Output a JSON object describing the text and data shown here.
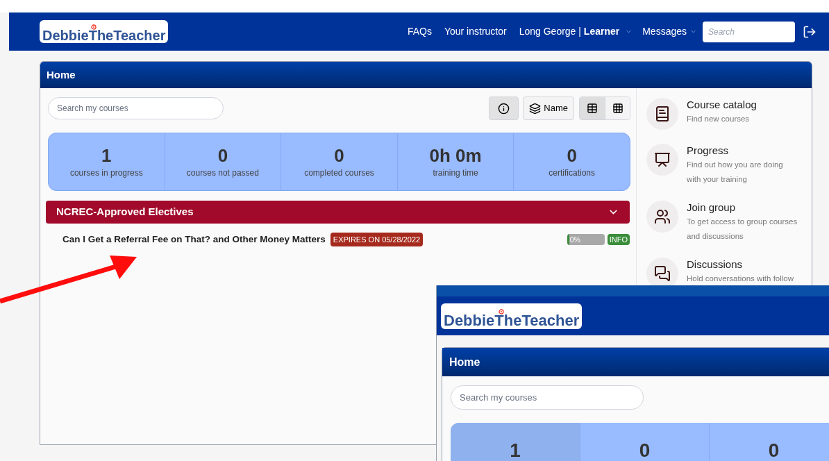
{
  "nav": {
    "logo": "DebbieTheTeacher",
    "links": [
      "FAQs",
      "Your instructor"
    ],
    "user": {
      "name": "Long George",
      "separator": "|",
      "role": "Learner"
    },
    "messages": "Messages",
    "search": {
      "placeholder": "Search"
    }
  },
  "home": {
    "title": "Home",
    "search": {
      "placeholder": "Search my courses"
    },
    "sort_label": "Name",
    "info_pressed": true,
    "views": [
      {
        "kind": "list",
        "selected": true
      },
      {
        "kind": "grid",
        "selected": false
      }
    ],
    "stats": [
      {
        "value": "1",
        "label": "courses in progress"
      },
      {
        "value": "0",
        "label": "courses not passed"
      },
      {
        "value": "0",
        "label": "completed courses"
      },
      {
        "value": "0h 0m",
        "label": "training time"
      },
      {
        "value": "0",
        "label": "certifications"
      }
    ],
    "categories": [
      {
        "title": "NCREC-Approved Electives",
        "expanded": true,
        "courses": [
          {
            "title": "Can I Get a Referral Fee on That? and Other Money Matters",
            "expires": "EXPIRES ON 05/28/2022",
            "level": 0,
            "progress": "0%",
            "info": "INFO"
          }
        ]
      }
    ],
    "sidebar": [
      {
        "kind": "catalog",
        "title": "Course catalog",
        "description": "Find new courses"
      },
      {
        "kind": "progress",
        "title": "Progress",
        "description": "Find out how you are doing with your training"
      },
      {
        "kind": "group",
        "title": "Join group",
        "description": "To get access to group courses and discussions"
      },
      {
        "kind": "discussions",
        "title": "Discussions",
        "description": "Hold conversations with follow"
      }
    ]
  },
  "overlay": {
    "logo": "DebbieTheTeacher",
    "title": "Home",
    "search": {
      "placeholder": "Search my courses"
    },
    "stats": [
      {
        "value": "1",
        "highlighted": true
      },
      {
        "value": "0",
        "highlighted": false
      },
      {
        "value": "0",
        "highlighted": false
      }
    ]
  }
}
